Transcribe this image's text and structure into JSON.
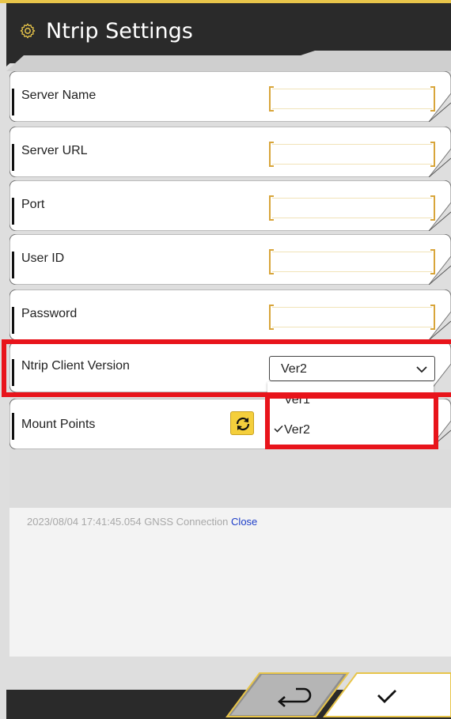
{
  "header": {
    "title": "Ntrip Settings",
    "icon": "gear-icon"
  },
  "fields": [
    {
      "label": "Server Name",
      "value": ""
    },
    {
      "label": "Server URL",
      "value": ""
    },
    {
      "label": "Port",
      "value": ""
    },
    {
      "label": "User ID",
      "value": ""
    },
    {
      "label": "Password",
      "value": ""
    }
  ],
  "version": {
    "label": "Ntrip Client Version",
    "selected": "Ver2",
    "options": [
      {
        "label": "Ver1",
        "checked": false
      },
      {
        "label": "Ver2",
        "checked": true
      }
    ]
  },
  "mount_points": {
    "label": "Mount Points",
    "refresh_icon": "refresh-icon"
  },
  "log": {
    "timestamp_text": "2023/08/04 17:41:45.054 GNSS Connection",
    "status": "Close"
  },
  "footer": {
    "back_icon": "return-icon",
    "confirm_icon": "checkmark-icon"
  },
  "colors": {
    "accent": "#e8c54a",
    "header_bg": "#2a2a2a",
    "highlight": "#e8141b",
    "link": "#1b3cc8"
  }
}
